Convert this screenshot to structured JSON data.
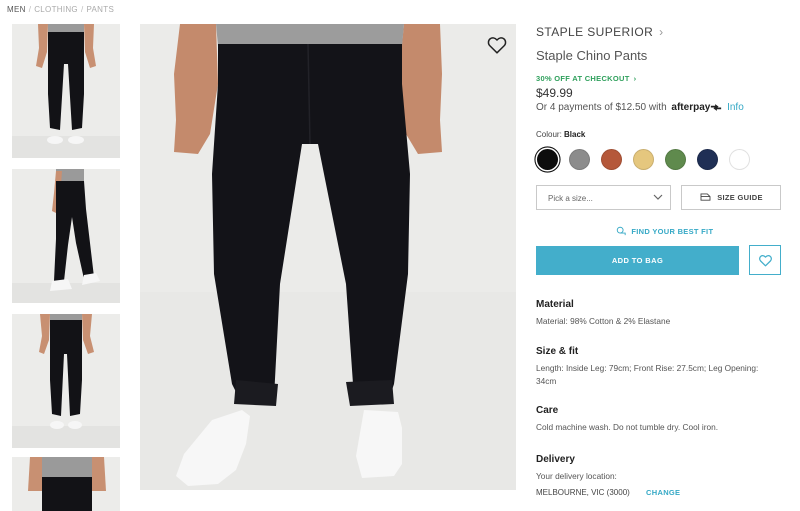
{
  "breadcrumb": {
    "items": [
      "MEN",
      "CLOTHING",
      "PANTS"
    ],
    "separator": "/"
  },
  "gallery": {
    "thumbnail_count": 4,
    "selected_index": 0
  },
  "product": {
    "brand": "STAPLE SUPERIOR",
    "name": "Staple Chino Pants",
    "promo": "30% OFF AT CHECKOUT",
    "price": "$49.99",
    "afterpay": {
      "text": "Or 4 payments of $12.50 with",
      "logo": "afterpay",
      "info_link": "Info"
    }
  },
  "colour": {
    "label": "Colour:",
    "selected": "Black",
    "swatches": [
      {
        "name": "Black",
        "hex": "#0d0d0d"
      },
      {
        "name": "Grey",
        "hex": "#8c8c8c"
      },
      {
        "name": "Rust",
        "hex": "#b5583a"
      },
      {
        "name": "Sand",
        "hex": "#e5c77e"
      },
      {
        "name": "Olive",
        "hex": "#5f8a4d"
      },
      {
        "name": "Navy",
        "hex": "#1f2f55"
      },
      {
        "name": "White",
        "hex": "#ffffff"
      }
    ]
  },
  "size": {
    "placeholder": "Pick a size...",
    "guide_label": "SIZE GUIDE"
  },
  "fit": {
    "label": "FIND YOUR BEST FIT"
  },
  "actions": {
    "add_to_bag": "ADD TO BAG"
  },
  "details": {
    "material": {
      "title": "Material",
      "text": "Material: 98% Cotton & 2% Elastane"
    },
    "size_fit": {
      "title": "Size & fit",
      "text": "Length: Inside Leg: 79cm; Front Rise: 27.5cm; Leg Opening: 34cm"
    },
    "care": {
      "title": "Care",
      "text": "Cold machine wash. Do not tumble dry. Cool iron."
    },
    "delivery": {
      "title": "Delivery",
      "subtitle": "Your delivery location:",
      "location": "MELBOURNE, VIC (3000)",
      "change": "CHANGE"
    }
  },
  "colors": {
    "accent": "#43aecb",
    "link": "#36a9c6",
    "promo": "#2fa05c"
  },
  "icons": {
    "wishlist": "heart-icon",
    "size_guide": "hanger-icon",
    "best_fit": "tape-measure-icon",
    "chevron": "chevron-right-icon",
    "dropdown": "chevron-down-icon"
  }
}
